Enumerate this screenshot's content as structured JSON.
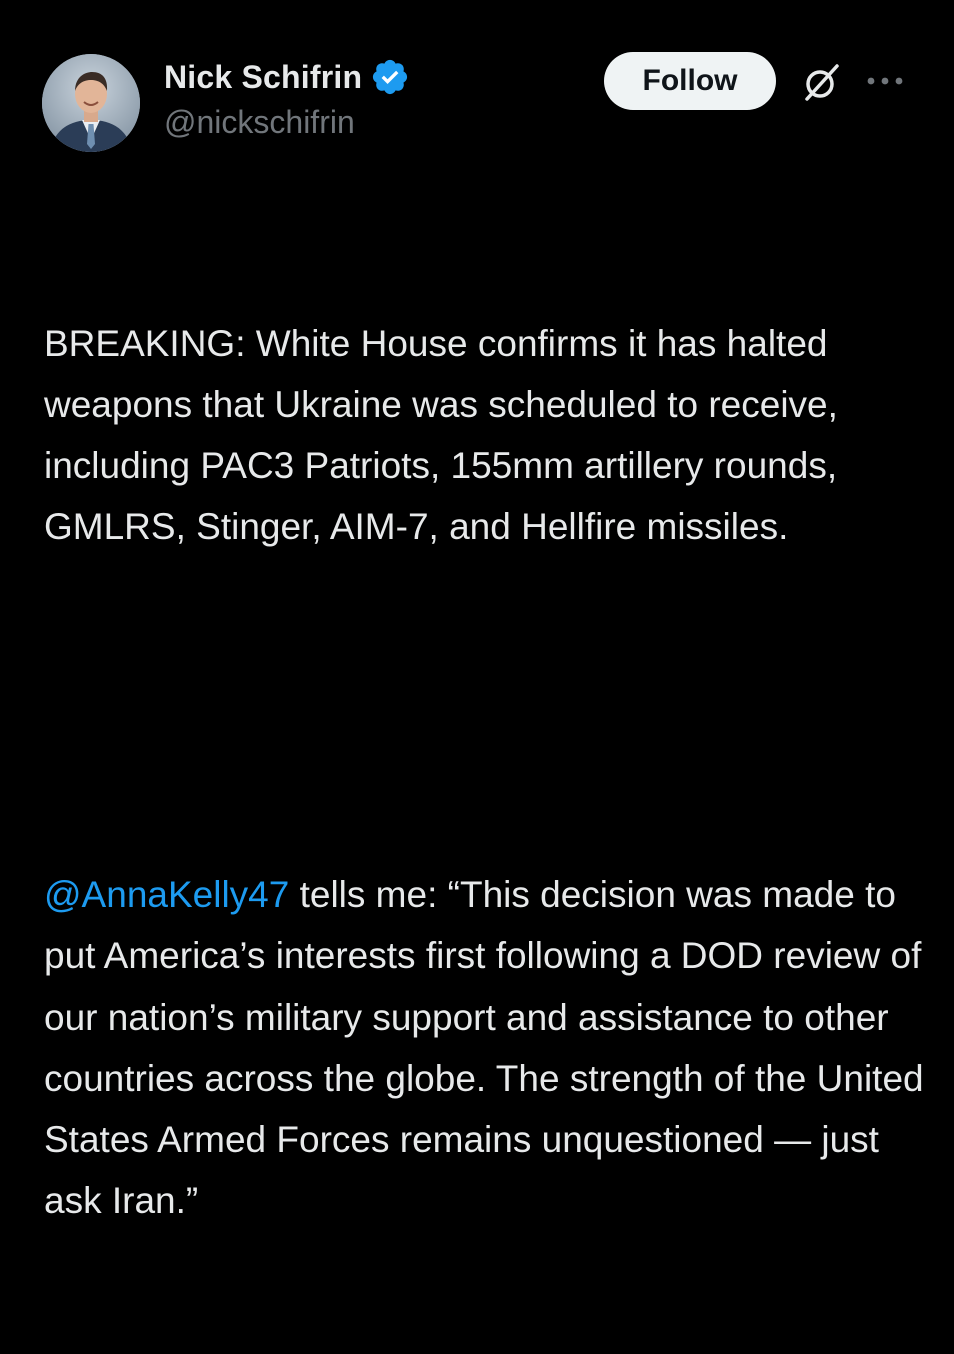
{
  "author": {
    "display_name": "Nick Schifrin",
    "handle": "@nickschifrin",
    "verified_icon": "verified-badge-icon",
    "avatar_icon": "avatar-photo"
  },
  "actions": {
    "follow_label": "Follow",
    "grok_icon": "grok-icon",
    "more_icon": "more-options-icon"
  },
  "tweet": {
    "paragraph1": "BREAKING: White House confirms it has halted weapons that Ukraine was scheduled to receive, including PAC3 Patriots, 155mm artillery rounds, GMLRS, Stinger, AIM-7, and Hellfire missiles.",
    "mention": "@AnnaKelly47",
    "paragraph2_rest": " tells me: “This decision was made to put America’s interests first following a DOD review of our nation’s military support and assistance to other countries across the globe. The strength of the United States Armed Forces remains unquestioned — just ask Iran.”"
  },
  "colors": {
    "background": "#000000",
    "text": "#e7e9ea",
    "secondary_text": "#71767b",
    "link": "#1d9bf0",
    "verified": "#1d9bf0",
    "follow_bg": "#eff3f4"
  }
}
